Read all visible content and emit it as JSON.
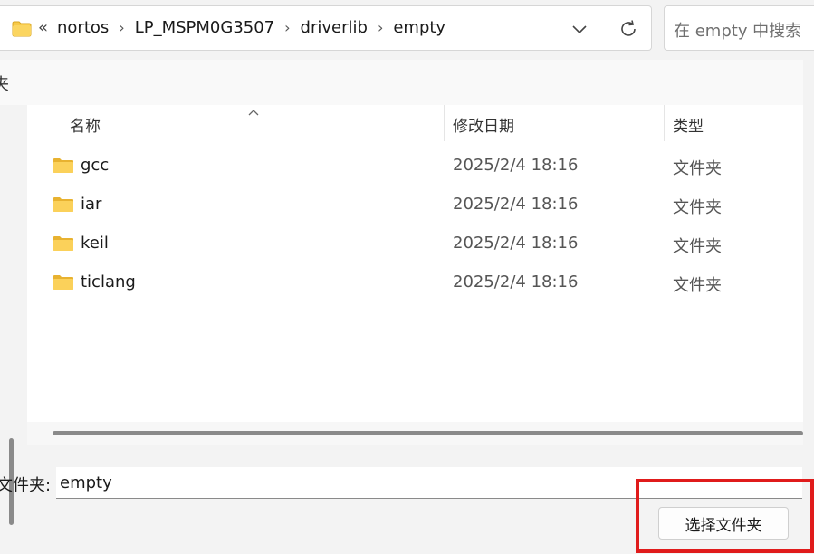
{
  "address_bar": {
    "lead": "«",
    "crumbs": [
      "nortos",
      "LP_MSPM0G3507",
      "driverlib",
      "empty"
    ]
  },
  "search": {
    "placeholder": "在 empty 中搜索"
  },
  "toolbar": {
    "fragment": "夹"
  },
  "columns": {
    "name": "名称",
    "modified": "修改日期",
    "type": "类型"
  },
  "files": [
    {
      "name": "gcc",
      "modified": "2025/2/4 18:16",
      "type": "文件夹",
      "icon": "folder-icon"
    },
    {
      "name": "iar",
      "modified": "2025/2/4 18:16",
      "type": "文件夹",
      "icon": "folder-icon"
    },
    {
      "name": "keil",
      "modified": "2025/2/4 18:16",
      "type": "文件夹",
      "icon": "folder-icon"
    },
    {
      "name": "ticlang",
      "modified": "2025/2/4 18:16",
      "type": "文件夹",
      "icon": "folder-icon"
    }
  ],
  "footer": {
    "folder_label": "文件夹:",
    "folder_value": "empty",
    "select_button": "选择文件夹"
  },
  "colors": {
    "folder": "#f7c948",
    "highlight": "#e01b1b",
    "accent": "#0067c0"
  }
}
